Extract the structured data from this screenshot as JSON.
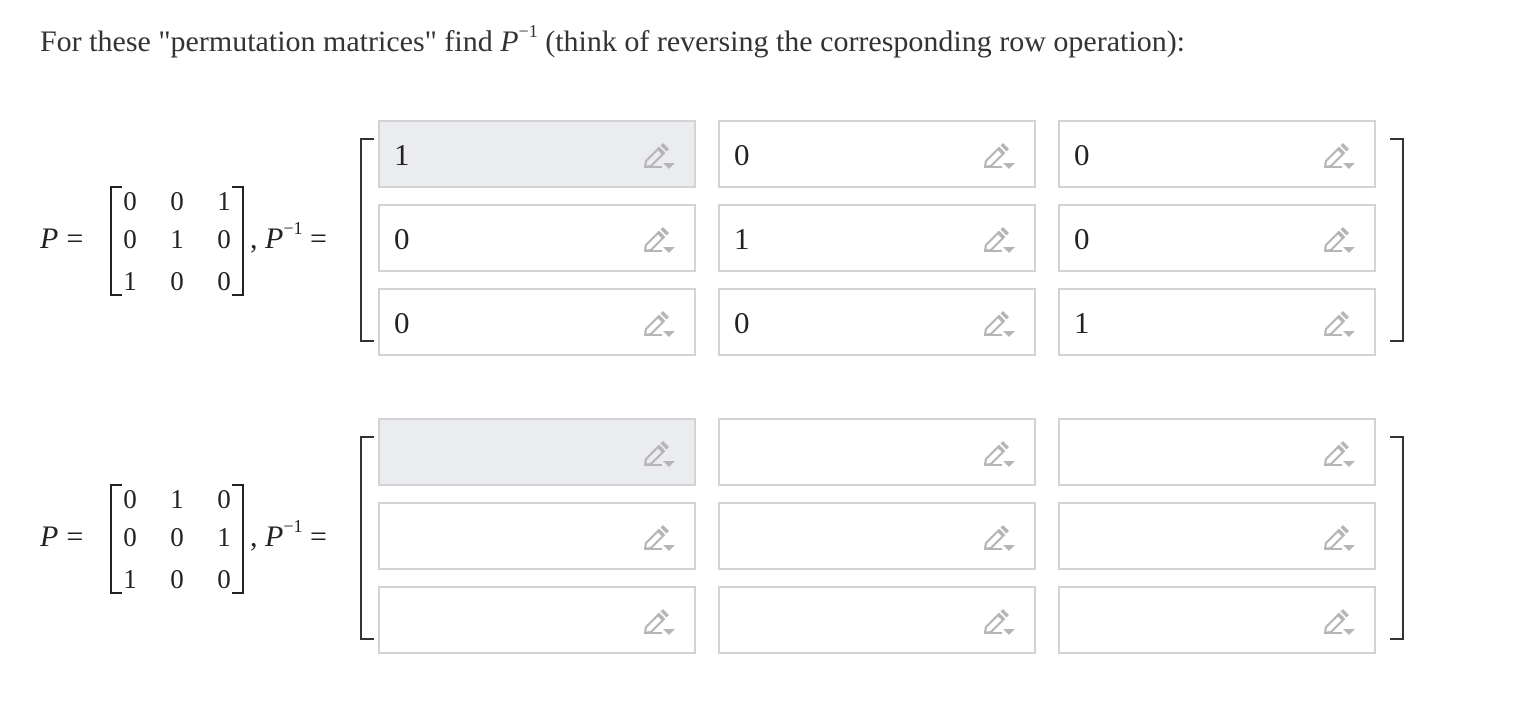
{
  "prompt": {
    "before": "For these \"permutation matrices\" find ",
    "var": "P",
    "sup": "−1",
    "after": " (think of reversing the corresponding row operation):"
  },
  "symbols": {
    "P": "P",
    "eq": "=",
    "comma": ",",
    "inv_sup": "−1"
  },
  "icons": {
    "edit": "pencil-dropdown-icon"
  },
  "colors": {
    "field_border": "#d3d3d3",
    "focused_bg": "#ebecef",
    "icon": "#b5b5b5"
  },
  "problems": [
    {
      "matrix": [
        [
          "0",
          "0",
          "1"
        ],
        [
          "0",
          "1",
          "0"
        ],
        [
          "1",
          "0",
          "0"
        ]
      ],
      "inverse_inputs": [
        [
          "1",
          "0",
          "0"
        ],
        [
          "0",
          "1",
          "0"
        ],
        [
          "0",
          "0",
          "1"
        ]
      ]
    },
    {
      "matrix": [
        [
          "0",
          "1",
          "0"
        ],
        [
          "0",
          "0",
          "1"
        ],
        [
          "1",
          "0",
          "0"
        ]
      ],
      "inverse_inputs": [
        [
          "",
          "",
          ""
        ],
        [
          "",
          "",
          ""
        ],
        [
          "",
          "",
          ""
        ]
      ]
    }
  ]
}
